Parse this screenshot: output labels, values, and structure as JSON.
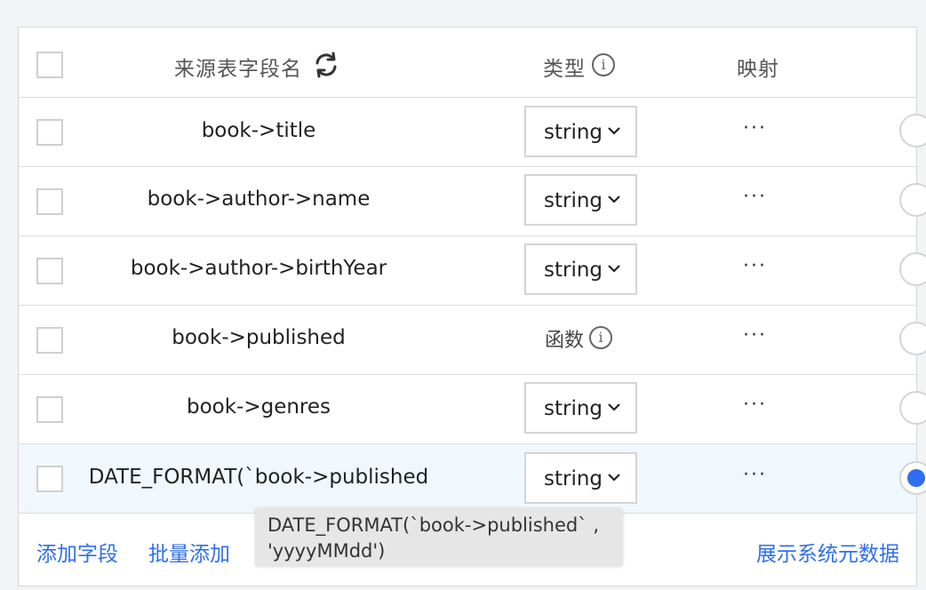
{
  "header": {
    "source_field_label": "来源表字段名",
    "type_label": "类型",
    "mapping_label": "映射"
  },
  "rows": [
    {
      "name": "book->title",
      "type": "string",
      "kind": "select",
      "actions": "···"
    },
    {
      "name": "book->author->name",
      "type": "string",
      "kind": "select",
      "actions": "···"
    },
    {
      "name": "book->author->birthYear",
      "type": "string",
      "kind": "select",
      "actions": "···"
    },
    {
      "name": "book->published",
      "type": "函数",
      "kind": "function",
      "actions": "···"
    },
    {
      "name": "book->genres",
      "type": "string",
      "kind": "select",
      "actions": "···"
    },
    {
      "name": "DATE_FORMAT(`book->published",
      "type": "string",
      "kind": "select",
      "actions": "···",
      "selected": true
    }
  ],
  "footer": {
    "add_field": "添加字段",
    "bulk_add": "批量添加",
    "show_system_metadata": "展示系统元数据"
  },
  "tooltip": {
    "line1": "DATE_FORMAT(`book->published` ,",
    "line2": "'yyyyMMdd')"
  },
  "colors": {
    "accent": "#2f6ef0",
    "selected_row": "#f1f8fd"
  }
}
